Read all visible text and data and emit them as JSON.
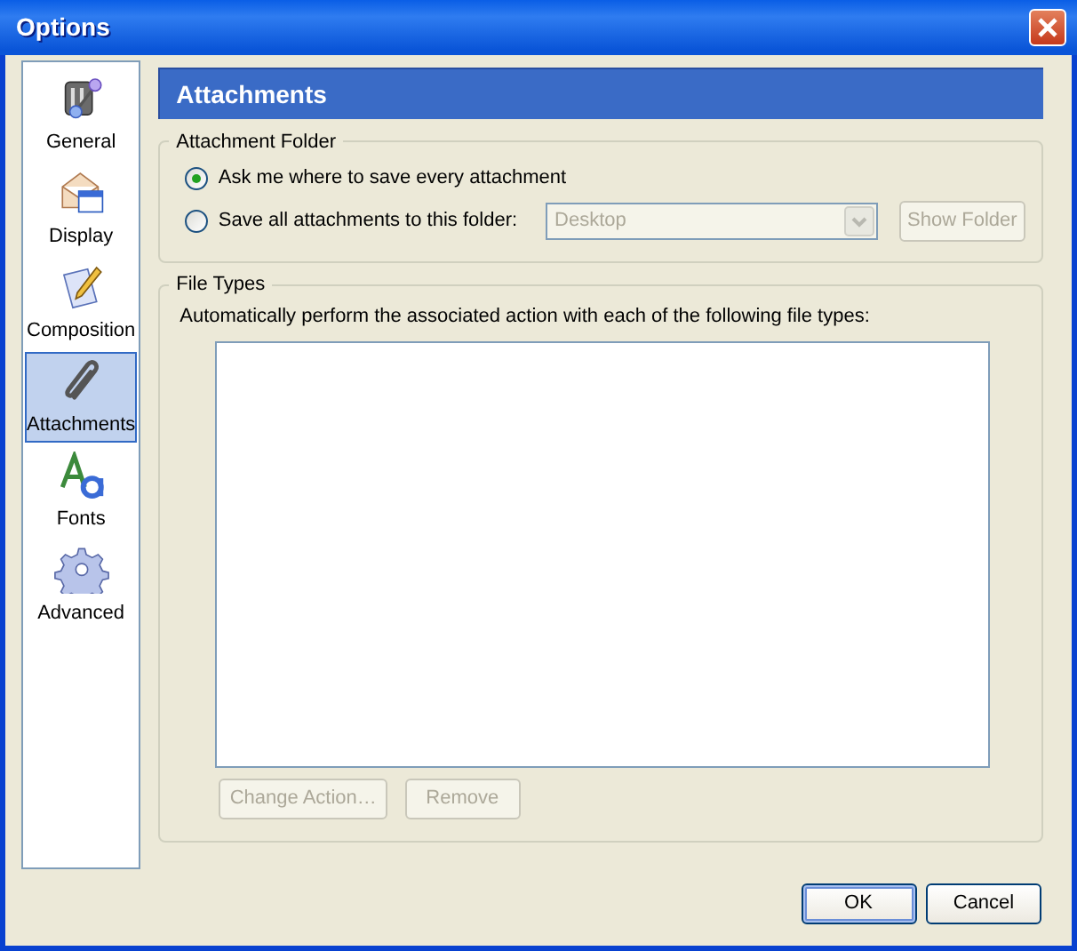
{
  "window": {
    "title": "Options"
  },
  "sidebar": {
    "items": [
      {
        "label": "General",
        "kind": "general",
        "selected": false
      },
      {
        "label": "Display",
        "kind": "display",
        "selected": false
      },
      {
        "label": "Composition",
        "kind": "composition",
        "selected": false
      },
      {
        "label": "Attachments",
        "kind": "attachments",
        "selected": true
      },
      {
        "label": "Fonts",
        "kind": "fonts",
        "selected": false
      },
      {
        "label": "Advanced",
        "kind": "advanced",
        "selected": false
      }
    ]
  },
  "panel": {
    "title": "Attachments"
  },
  "attachment_folder": {
    "legend": "Attachment Folder",
    "options": [
      {
        "label": "Ask me where to save every attachment",
        "selected": true
      },
      {
        "label": "Save all attachments to this folder:",
        "selected": false
      }
    ],
    "folder": {
      "value": "Desktop",
      "disabled": true
    },
    "show_folder": {
      "label": "Show Folder",
      "disabled": true
    }
  },
  "file_types": {
    "legend": "File Types",
    "description": "Automatically perform the associated action with each of the following file types:",
    "buttons": [
      {
        "label": "Change Action…",
        "disabled": true
      },
      {
        "label": "Remove",
        "disabled": true
      }
    ]
  },
  "buttons": [
    {
      "label": "OK",
      "default": true
    },
    {
      "label": "Cancel",
      "default": false
    }
  ]
}
